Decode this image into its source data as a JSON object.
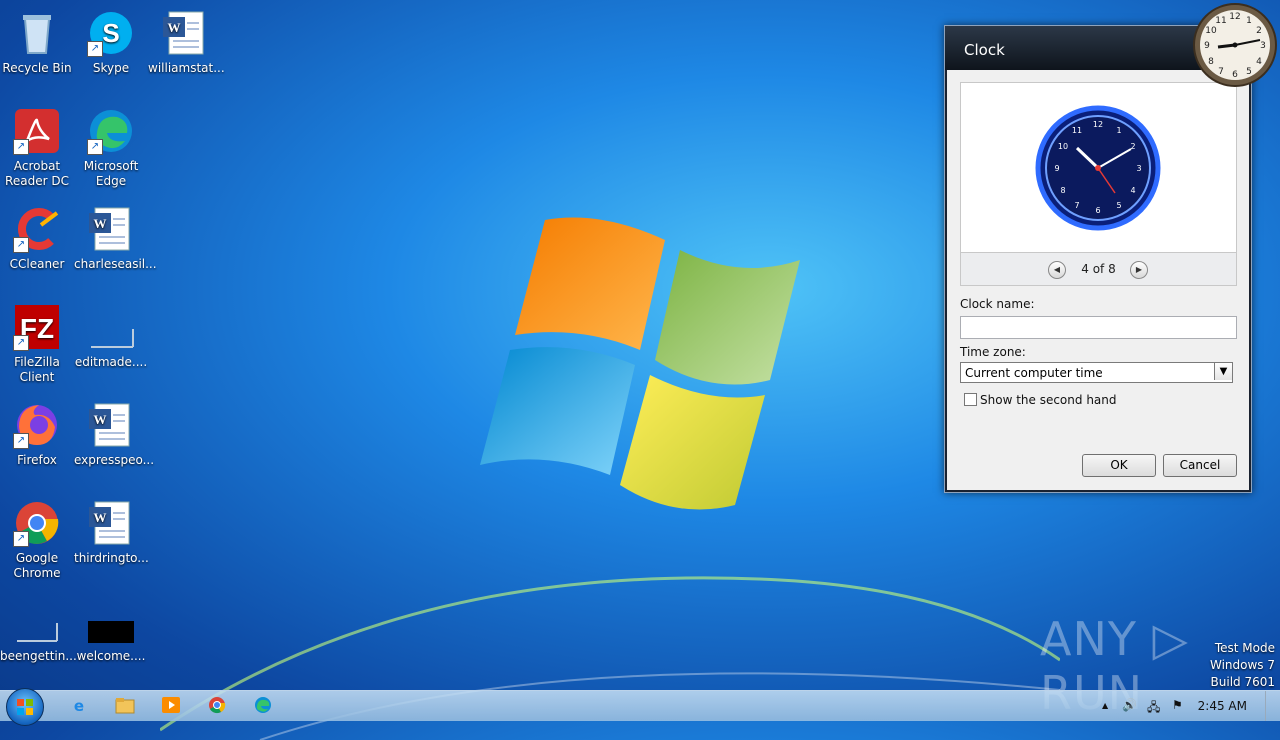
{
  "desktop": {
    "icons": [
      {
        "label": "Recycle Bin"
      },
      {
        "label": "Skype"
      },
      {
        "label": "williamstat..."
      },
      {
        "label": "Acrobat Reader DC"
      },
      {
        "label": "Microsoft Edge"
      },
      {
        "label": "CCleaner"
      },
      {
        "label": "charleseasil..."
      },
      {
        "label": "FileZilla Client"
      },
      {
        "label": "editmade...."
      },
      {
        "label": "Firefox"
      },
      {
        "label": "expresspeo..."
      },
      {
        "label": "Google Chrome"
      },
      {
        "label": "thirdringto..."
      },
      {
        "label": "beengettin..."
      },
      {
        "label": "welcome...."
      }
    ]
  },
  "dialog": {
    "title": "Clock",
    "pager": {
      "text": "4 of 8"
    },
    "clock_name_label": "Clock name:",
    "clock_name_value": "",
    "time_zone_label": "Time zone:",
    "time_zone_value": "Current computer time",
    "second_hand_label": "Show the second hand",
    "second_hand_checked": false,
    "ok_label": "OK",
    "cancel_label": "Cancel"
  },
  "watermark": {
    "text": "ANY ▷ RUN"
  },
  "test_mode": {
    "line1": "Test Mode",
    "line2": "Windows 7",
    "line3": "Build 7601"
  },
  "taskbar": {
    "time": "2:45 AM",
    "pinned": [
      "internet-explorer-icon",
      "folder-icon",
      "media-player-icon",
      "chrome-icon",
      "edge-icon"
    ],
    "tray_arrow": "▲"
  },
  "colors": {
    "accent": "#1e88e5",
    "clock_face": "#0a1f7a",
    "neon": "#2f6bff"
  }
}
